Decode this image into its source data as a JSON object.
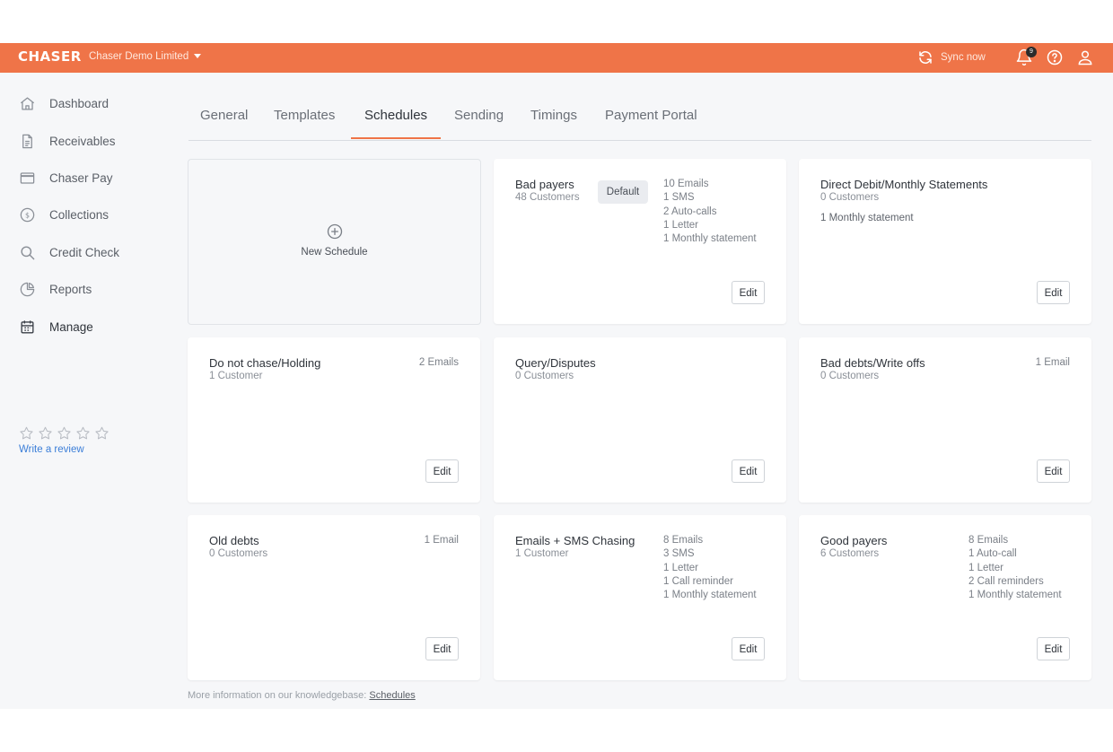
{
  "header": {
    "logo": "CHASER",
    "org_name": "Chaser Demo Limited",
    "sync_label": "Sync now",
    "notification_count": "9",
    "accent_color": "#ef7448"
  },
  "sidebar": {
    "items": [
      {
        "label": "Dashboard",
        "icon": "home-icon"
      },
      {
        "label": "Receivables",
        "icon": "document-icon"
      },
      {
        "label": "Chaser Pay",
        "icon": "credit-card-icon"
      },
      {
        "label": "Collections",
        "icon": "dollar-circle-icon"
      },
      {
        "label": "Credit Check",
        "icon": "search-icon"
      },
      {
        "label": "Reports",
        "icon": "pie-chart-icon"
      },
      {
        "label": "Manage",
        "icon": "calendar-icon"
      }
    ],
    "review_link": "Write a review",
    "rating_stars": 5
  },
  "tabs": [
    {
      "label": "General"
    },
    {
      "label": "Templates"
    },
    {
      "label": "Schedules",
      "active": true
    },
    {
      "label": "Sending"
    },
    {
      "label": "Timings"
    },
    {
      "label": "Payment Portal"
    }
  ],
  "new_schedule": {
    "label": "New Schedule"
  },
  "schedules": [
    {
      "title": "Bad payers",
      "customers": "48 Customers",
      "badge": "Default",
      "stats": [
        "10 Emails",
        "1 SMS",
        "2 Auto-calls",
        "1 Letter",
        "1 Monthly statement"
      ],
      "edit": "Edit"
    },
    {
      "title": "Direct Debit/Monthly Statements",
      "customers": "0 Customers",
      "extra": "1 Monthly statement",
      "edit": "Edit"
    },
    {
      "title": "Do not chase/Holding",
      "customers": "1 Customer",
      "stats": [
        "2 Emails"
      ],
      "edit": "Edit"
    },
    {
      "title": "Query/Disputes",
      "customers": "0 Customers",
      "edit": "Edit"
    },
    {
      "title": "Bad debts/Write offs",
      "customers": "0 Customers",
      "stats": [
        "1 Email"
      ],
      "edit": "Edit"
    },
    {
      "title": "Old debts",
      "customers": "0 Customers",
      "stats": [
        "1 Email"
      ],
      "edit": "Edit"
    },
    {
      "title": "Emails + SMS Chasing",
      "customers": "1 Customer",
      "stats": [
        "8 Emails",
        "3 SMS",
        "1 Letter",
        "1 Call reminder",
        "1 Monthly statement"
      ],
      "edit": "Edit"
    },
    {
      "title": "Good payers",
      "customers": "6 Customers",
      "stats": [
        "8 Emails",
        "1 Auto-call",
        "1 Letter",
        "2 Call reminders",
        "1 Monthly statement"
      ],
      "edit": "Edit"
    }
  ],
  "footer": {
    "text": "More information on our knowledgebase:",
    "link": "Schedules"
  }
}
